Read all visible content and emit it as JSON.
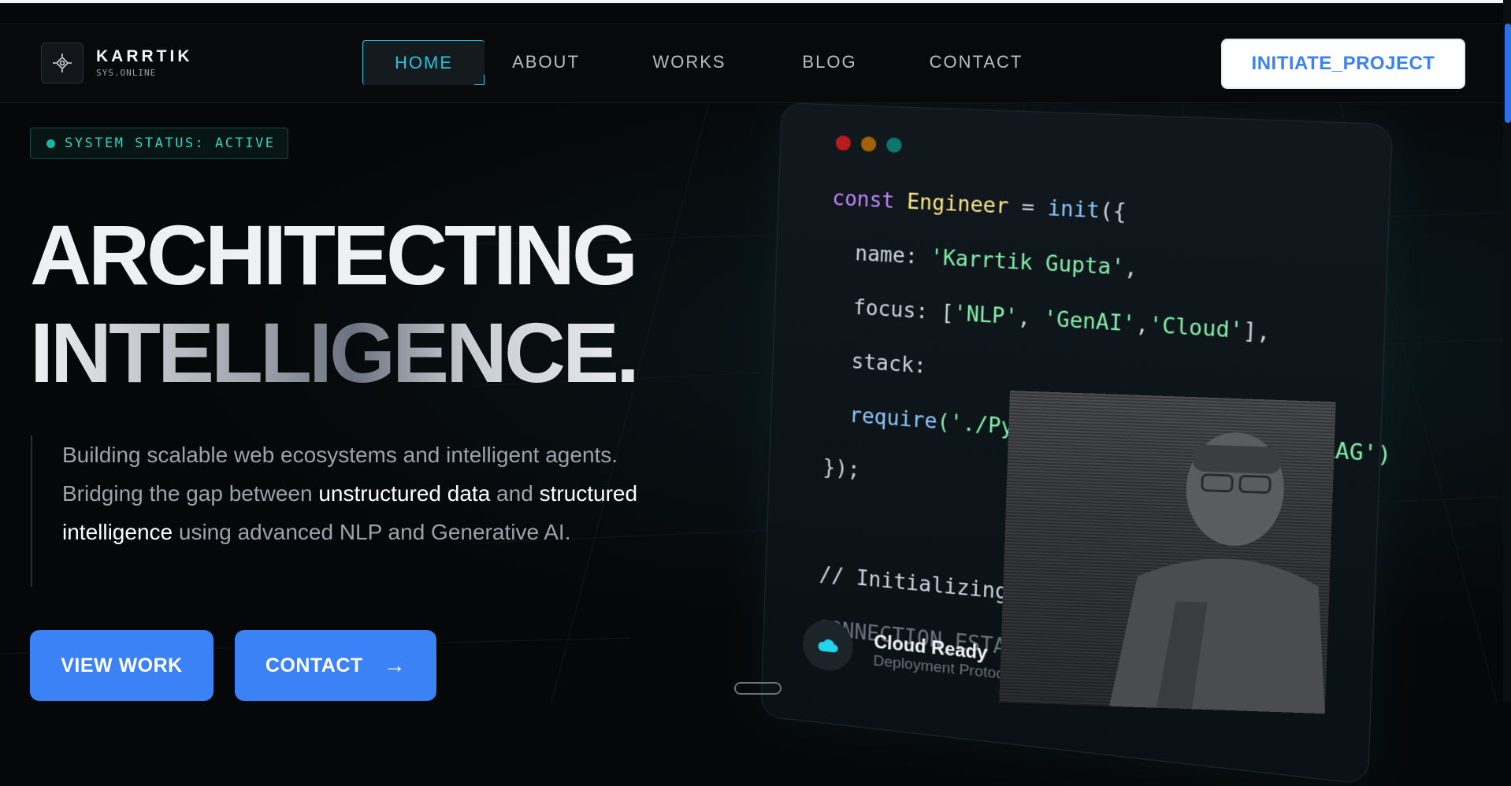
{
  "brand": {
    "name": "KARRTIK",
    "subtitle": "SYS.ONLINE"
  },
  "nav": {
    "items": [
      {
        "label": "HOME",
        "active": true
      },
      {
        "label": "ABOUT"
      },
      {
        "label": "WORKS"
      },
      {
        "label": "BLOG"
      },
      {
        "label": "CONTACT"
      }
    ]
  },
  "header_cta": "INITIATE_PROJECT",
  "status_badge": "SYSTEM STATUS: ACTIVE",
  "hero": {
    "title_line1": "ARCHITECTING",
    "title_line2": "INTELLIGENCE",
    "title_dot": ".",
    "desc_1": "Building scalable web ecosystems and intelligent agents. Bridging the gap between ",
    "desc_hl1": "unstructured data",
    "desc_2": " and ",
    "desc_hl2": "structured intelligence",
    "desc_3": " using advanced NLP and Generative AI."
  },
  "buttons": {
    "view_work": "VIEW WORK",
    "contact": "CONTACT"
  },
  "code_card": {
    "kw_const": "const",
    "class_name": "Engineer",
    "eq": " = ",
    "fn_init": "init",
    "open": "({",
    "name_key": "name: ",
    "name_val": "'Karrtik Gupta'",
    "focus_key": "focus: [",
    "focus_v1": "'NLP'",
    "focus_v2": "'GenAI'",
    "focus_v3": "'Cloud'",
    "focus_close": "],",
    "stack_key": "stack:",
    "require_fn": "require",
    "req_args": "('./Python','./LangChain','./RAG')",
    "close": "});",
    "comment": "// Initializing AI Agents...",
    "connection": "CONNECTION_ESTABLISHED",
    "cloud_title": "Cloud Ready",
    "cloud_sub": "Deployment Protocols Active"
  },
  "colors": {
    "accent": "#3b82f6",
    "cyan": "#22c7e0",
    "teal": "#2dd4bf",
    "bg": "#060708"
  }
}
